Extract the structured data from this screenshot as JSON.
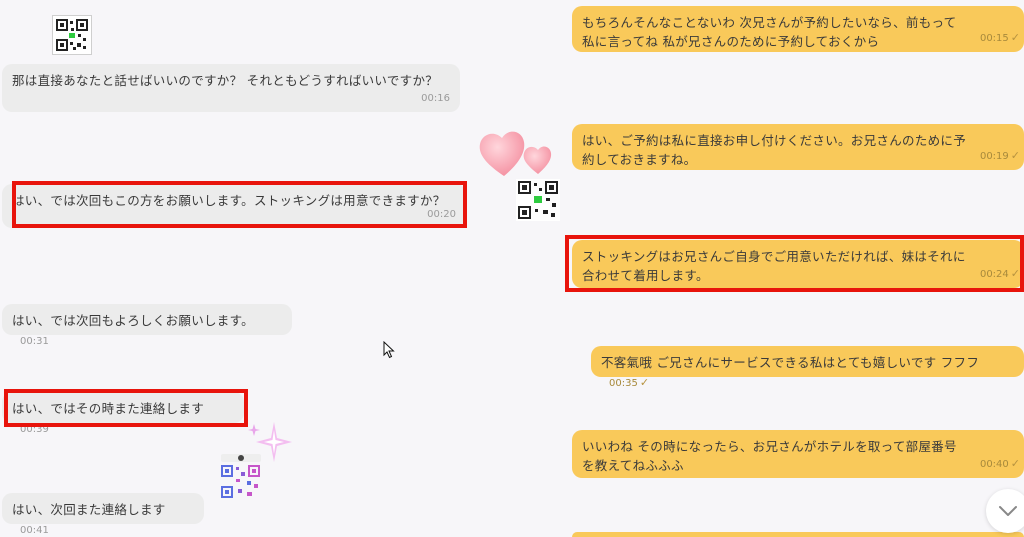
{
  "colors": {
    "background": "#f7f6f9",
    "incoming_bubble": "#ececec",
    "outgoing_bubble": "#f9c95a",
    "highlight_box": "#e8140c"
  },
  "messages": [
    {
      "side": "right",
      "text": "もちろんそんなことないわ 次兄さんが予約したいなら、前もって私に言ってね 私が兄さんのために予約しておくから",
      "time": "00:15",
      "status": "read-check-icon"
    },
    {
      "side": "left",
      "text": "那は直接あなたと話せばいいのですか？ それともどうすればいいですか？",
      "time": "00:16"
    },
    {
      "side": "right",
      "text": "はい、ご予約は私に直接お申し付けください。お兄さんのために予約しておきますね。",
      "time": "00:19",
      "status": "read-check-icon"
    },
    {
      "side": "left",
      "text": "はい、では次回もこの方をお願いします。ストッキングは用意できますか？",
      "time": "00:20"
    },
    {
      "side": "right",
      "text": "ストッキングはお兄さんご自身でご用意いただければ、妹はそれに合わせて着用します。",
      "time": "00:24",
      "status": "read-check-icon"
    },
    {
      "side": "left",
      "text": "はい、では次回もよろしくお願いします。",
      "time": "00:31"
    },
    {
      "side": "right",
      "text": "不客氣哦 ご兄さんにサービスできる私はとても嬉しいです フフフ",
      "time": "00:35",
      "status": "read-check-icon"
    },
    {
      "side": "left",
      "text": "はい、ではその時また連絡します",
      "time": "00:39"
    },
    {
      "side": "right",
      "text": "いいわね その時になったら、お兄さんがホテルを取って部屋番号を教えてねふふふ",
      "time": "00:40",
      "status": "read-check-icon"
    },
    {
      "side": "left",
      "text": "はい、次回また連絡します",
      "time": "00:41"
    }
  ],
  "stickers": [
    "qr-code-icon",
    "hearts-icon",
    "qr-code-icon",
    "sparkle-icon",
    "qr-code-icon"
  ],
  "controls": {
    "scroll_down": "chevron-down-icon"
  }
}
